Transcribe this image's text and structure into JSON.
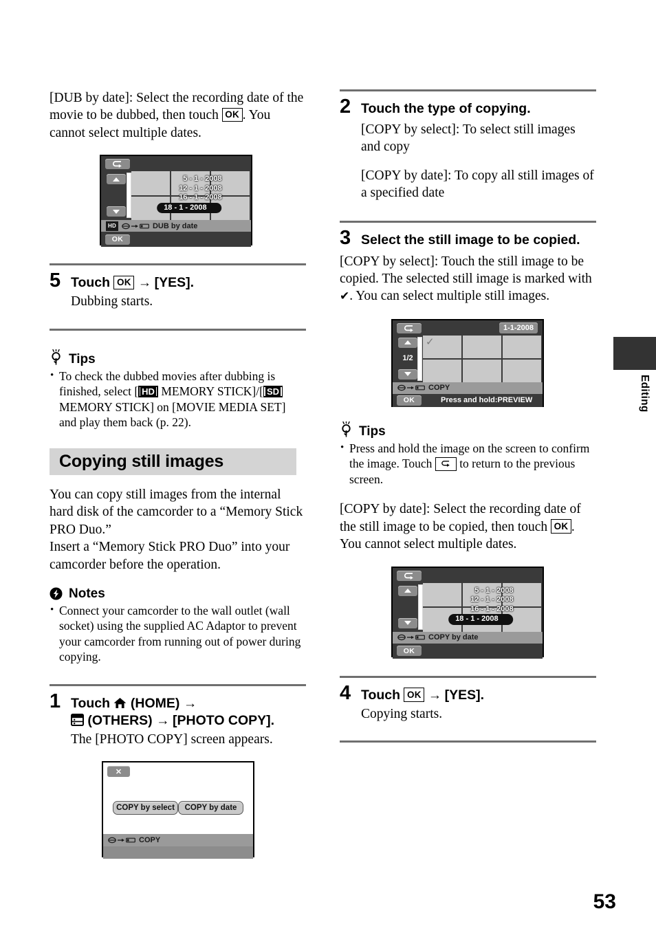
{
  "page": {
    "number": "53",
    "side_tab_label": "Editing"
  },
  "left_column": {
    "dub_by_date_para": {
      "part1": "[DUB by date]: Select the recording date of the movie to be dubbed, then touch",
      "key": "OK",
      "part2": ". You cannot select multiple dates."
    },
    "lcd_dub_by_date": {
      "back_icon": "return-arrow-icon",
      "up_icon": "triangle-up-icon",
      "down_icon": "triangle-down-icon",
      "dates": [
        "5 - 1 - 2008",
        "12 - 1 - 2008",
        "16 - 1 - 2008"
      ],
      "selected_date": "18 - 1 - 2008",
      "media_badge": "HD",
      "status_label": "DUB by date",
      "ok_label": "OK"
    },
    "step5": {
      "number": "5",
      "title_part1": "Touch",
      "title_key": "OK",
      "title_arrow": "→",
      "title_part2": "[YES].",
      "body": "Dubbing starts."
    },
    "tips": {
      "icon": "lightbulb-icon",
      "title": "Tips",
      "item": {
        "part1": "To check the dubbed movies after dubbing is finished, select [",
        "badge1": "HD",
        "part2": " MEMORY STICK]/[",
        "badge2": "SD",
        "part3": " MEMORY STICK] on [MOVIE MEDIA SET] and play them back (p. 22)."
      }
    },
    "section": {
      "title": "Copying still images",
      "intro1": "You can copy still images from the internal hard disk of the camcorder to a “Memory Stick PRO Duo.”",
      "intro2": "Insert a “Memory Stick PRO Duo” into your camcorder before the operation."
    },
    "notes": {
      "icon": "note-bolt-icon",
      "title": "Notes",
      "item": "Connect your camcorder to the wall outlet (wall socket) using the supplied AC Adaptor to prevent your camcorder from running out of power during copying."
    },
    "step1": {
      "number": "1",
      "title_touch": "Touch",
      "home_icon": "home-icon",
      "home_label": "(HOME)",
      "arrow1": "→",
      "others_icon": "others-icon",
      "others_label": "(OTHERS)",
      "arrow2": "→",
      "target_label": "[PHOTO COPY].",
      "body": "The [PHOTO COPY] screen appears."
    },
    "lcd_photo_copy": {
      "close_icon": "close-x-icon",
      "choice_left": "COPY by select",
      "choice_right": "COPY by date",
      "status_label": "COPY"
    }
  },
  "right_column": {
    "step2": {
      "number": "2",
      "title": "Touch the type of copying.",
      "body1": "[COPY by select]: To select still images and copy",
      "body2": "[COPY by date]: To copy all still images of a specified date"
    },
    "step3": {
      "number": "3",
      "title": "Select the still image to be copied.",
      "body_part1": "[COPY by select]: Touch the still image to be copied. The selected still image is marked with",
      "body_check": "✔",
      "body_part2": ". You can select multiple still images."
    },
    "lcd_copy_by_select": {
      "back_icon": "return-arrow-icon",
      "date_chip": "1-1-2008",
      "page_indicator": "1/2",
      "up_icon": "triangle-up-icon",
      "down_icon": "triangle-down-icon",
      "checked_cell_icon": "check-icon",
      "status_label": "COPY",
      "ok_label": "OK",
      "hint": "Press and hold:PREVIEW"
    },
    "tips": {
      "icon": "lightbulb-icon",
      "title": "Tips",
      "item": {
        "part1": "Press and hold the image on the screen to confirm the image. Touch",
        "key_icon": "return-arrow-icon",
        "part2": "to return to the previous screen."
      }
    },
    "copy_by_date_para": {
      "part1": "[COPY by date]: Select the recording date of the still image to be copied, then touch",
      "key": "OK",
      "part2": ". You cannot select multiple dates."
    },
    "lcd_copy_by_date": {
      "back_icon": "return-arrow-icon",
      "up_icon": "triangle-up-icon",
      "down_icon": "triangle-down-icon",
      "dates": [
        "5 - 1 - 2008",
        "12 - 1 - 2008",
        "16 - 1 - 2008"
      ],
      "selected_date": "18 - 1 - 2008",
      "status_label": "COPY by date",
      "ok_label": "OK"
    },
    "step4": {
      "number": "4",
      "title_part1": "Touch",
      "title_key": "OK",
      "title_arrow": "→",
      "title_part2": "[YES].",
      "body": "Copying starts."
    }
  }
}
